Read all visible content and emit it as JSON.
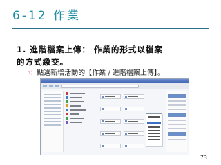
{
  "slide": {
    "title": "6-12 作業",
    "point_lines": [
      "1. 進階檔案上傳： 作業的形式以檔案",
      "的方式繳交。"
    ],
    "subpoint_number": "1)",
    "subpoint_text": "點選新增活動的【作業 / 進階檔案上傳】。",
    "page_number": "73"
  },
  "colors": {
    "title": "#1f8da3",
    "rule": "#2f6f8e",
    "subpoint_number": "#f0a0a0"
  }
}
